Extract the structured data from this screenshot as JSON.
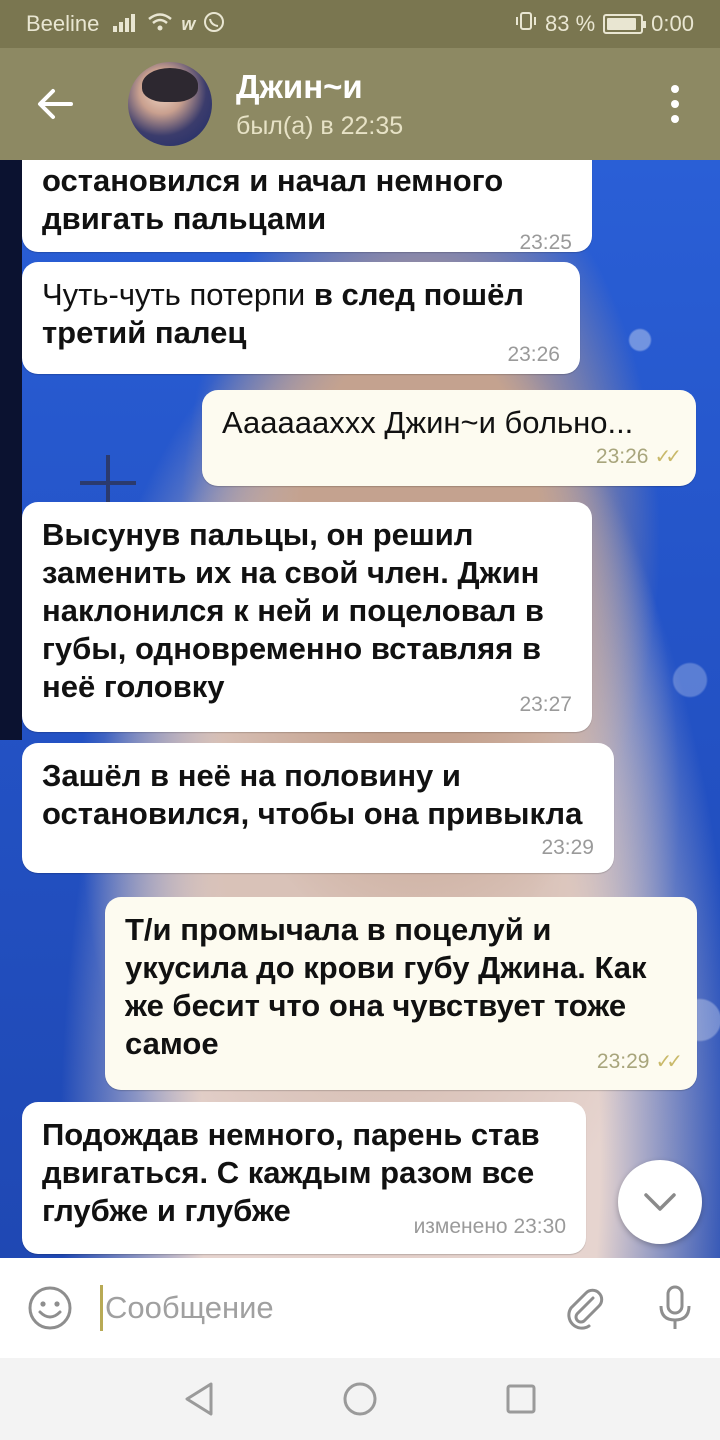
{
  "status_bar": {
    "carrier": "Beeline",
    "battery": "83 %",
    "time": "0:00",
    "battery_level": 0.83
  },
  "header": {
    "title": "Джин~и",
    "last_seen": "был(а) в 22:35"
  },
  "messages": [
    {
      "direction": "in",
      "text": "остановился и начал немного\nдвигать пальцами",
      "time": "23:25"
    },
    {
      "direction": "in",
      "text_plain": "Чуть-чуть потерпи ",
      "text": "в след пошёл\nтретий палец",
      "time": "23:26"
    },
    {
      "direction": "out",
      "text": "Аааааахxx Джин~и больно...",
      "time": "23:26",
      "read": true
    },
    {
      "direction": "in",
      "text": "Высунув пальцы, он решил\nзаменить их на свой член. Джин\nнаклонился к ней и поцеловал в\nгубы, одновременно вставляя в\nнеё головку",
      "time": "23:27"
    },
    {
      "direction": "in",
      "text": "Зашёл в неё на половину  и\nостановился, чтобы она привыкла",
      "time": "23:29"
    },
    {
      "direction": "out",
      "text": "Т/и промычала в поцелуй и\nукусила до крови губу Джина. Как\nже бесит что она чувствует тоже\nсамое",
      "time": "23:29",
      "read": true
    },
    {
      "direction": "in",
      "text": "Подождав немного, парень став\nдвигаться. С каждым разом все\nглубже и глубже",
      "time": "изменено 23:30"
    }
  ],
  "compose": {
    "placeholder": "Сообщение"
  },
  "icons": {
    "back": "back-arrow-icon",
    "menu": "more-vert-icon",
    "emoji": "emoji-icon",
    "attach": "paperclip-icon",
    "mic": "microphone-icon",
    "scroll_down": "chevron-down-icon"
  }
}
